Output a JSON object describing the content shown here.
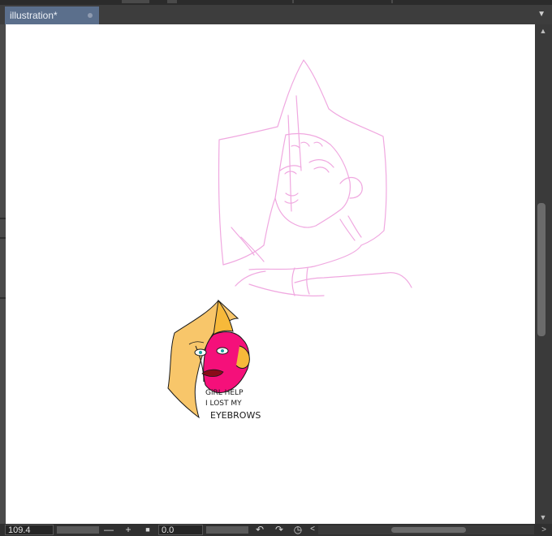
{
  "document_tab": {
    "title": "illustration*"
  },
  "canvas": {
    "doodle_caption": [
      "GiRL HELP",
      "I LOST MY",
      "EYEBROWS"
    ]
  },
  "status_bar": {
    "zoom_value": "109.4",
    "zoom_out_glyph": "—",
    "zoom_in_glyph": "+",
    "fit_glyph": "■",
    "rotation_value": "0.0",
    "rotate_left_glyph": "↶",
    "rotate_right_glyph": "↷",
    "reset_rotation_glyph": "◷",
    "scroll_left_glyph": "<",
    "scroll_right_glyph": ">"
  },
  "icons": {
    "tab_menu": "chevron-down-icon",
    "vscroll_up": "chevron-up-icon",
    "vscroll_down": "chevron-down-icon"
  },
  "colors": {
    "tab_active": "#5b6f8c",
    "sketch_line": "#f0a8e0",
    "hood_fill": "#f8c66a",
    "face_fill": "#f5107a",
    "lips": "#8a0c18"
  }
}
